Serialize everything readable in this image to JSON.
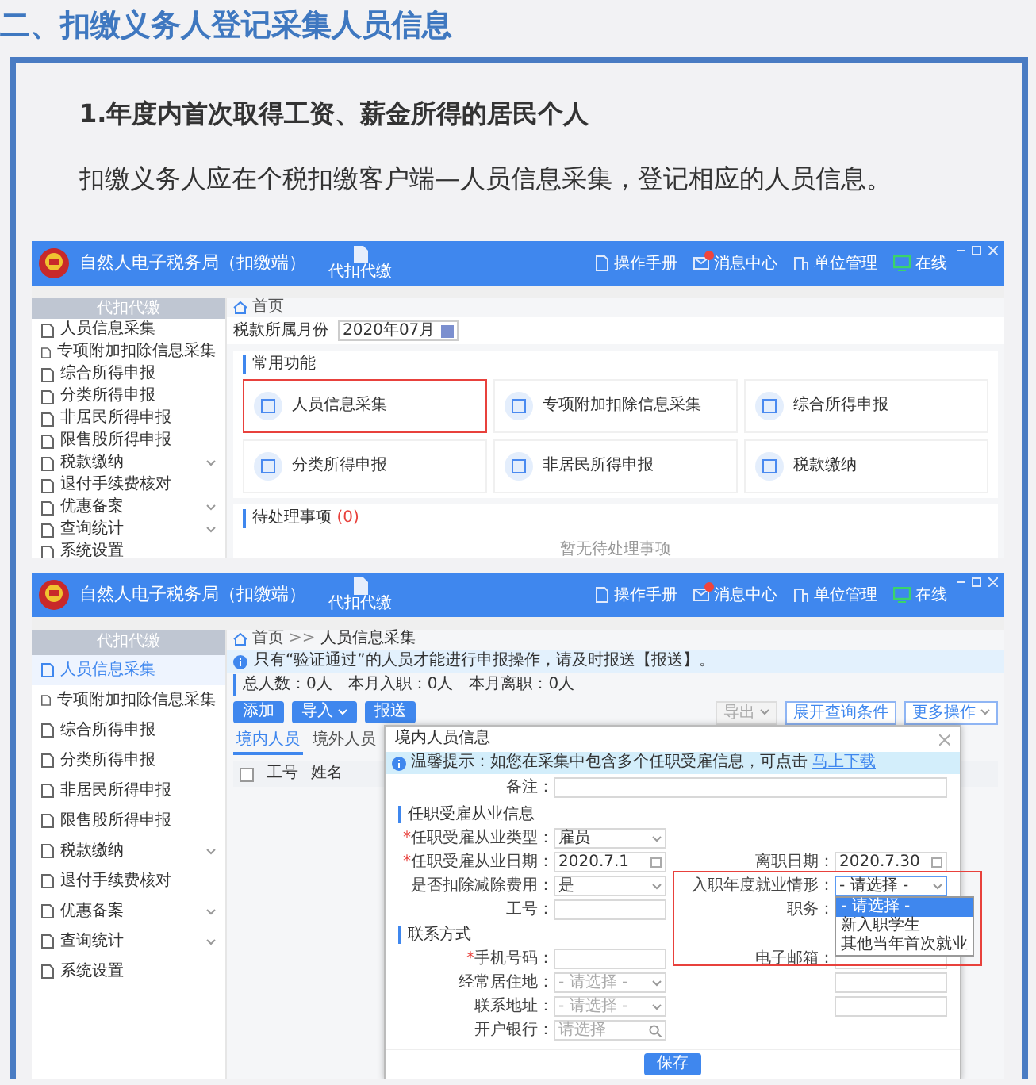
{
  "heading": "二、扣缴义务人登记采集人员信息",
  "subheading": "1.年度内首次取得工资、薪金所得的居民个人",
  "paragraph": "扣缴义务人应在个税扣缴客户端—人员信息采集，登记相应的人员信息。",
  "screenshot_1": {
    "app_title": "自然人电子税务局（扣缴端）",
    "toolbar_button": "代扣代缴",
    "header_links": [
      {
        "label": "操作手册",
        "kind": "manual",
        "badge": false
      },
      {
        "label": "消息中心",
        "kind": "message",
        "badge": true
      },
      {
        "label": "单位管理",
        "kind": "unit",
        "badge": false
      },
      {
        "label": "在线",
        "kind": "online",
        "badge": false
      }
    ],
    "sidebar_title": "代扣代缴",
    "sidebar_items": [
      {
        "label": "人员信息采集",
        "expandable": false,
        "selected": false
      },
      {
        "label": "专项附加扣除信息采集",
        "expandable": false,
        "selected": false
      },
      {
        "label": "综合所得申报",
        "expandable": false,
        "selected": false
      },
      {
        "label": "分类所得申报",
        "expandable": false,
        "selected": false
      },
      {
        "label": "非居民所得申报",
        "expandable": false,
        "selected": false
      },
      {
        "label": "限售股所得申报",
        "expandable": false,
        "selected": false
      },
      {
        "label": "税款缴纳",
        "expandable": true,
        "selected": false
      },
      {
        "label": "退付手续费核对",
        "expandable": false,
        "selected": false
      },
      {
        "label": "优惠备案",
        "expandable": true,
        "selected": false
      },
      {
        "label": "查询统计",
        "expandable": true,
        "selected": false
      },
      {
        "label": "系统设置",
        "expandable": false,
        "selected": false
      }
    ],
    "breadcrumb": [
      "首页"
    ],
    "month_label": "税款所属月份",
    "month_value": "2020年07月",
    "functions_title": "常用功能",
    "functions": [
      {
        "title": "人员信息采集",
        "highlighted": true
      },
      {
        "title": "专项附加扣除信息采集",
        "highlighted": false
      },
      {
        "title": "综合所得申报",
        "highlighted": false
      },
      {
        "title": "分类所得申报",
        "highlighted": false
      },
      {
        "title": "非居民所得申报",
        "highlighted": false
      },
      {
        "title": "税款缴纳",
        "highlighted": false
      }
    ],
    "pending_title": "待处理事项",
    "pending_count": "(0)",
    "pending_empty": "暂无待处理事项"
  },
  "screenshot_2": {
    "app_title": "自然人电子税务局（扣缴端）",
    "toolbar_button": "代扣代缴",
    "header_links": [
      {
        "label": "操作手册",
        "kind": "manual",
        "badge": false
      },
      {
        "label": "消息中心",
        "kind": "message",
        "badge": true
      },
      {
        "label": "单位管理",
        "kind": "unit",
        "badge": false
      },
      {
        "label": "在线",
        "kind": "online",
        "badge": false
      }
    ],
    "sidebar_title": "代扣代缴",
    "sidebar_items": [
      {
        "label": "人员信息采集",
        "expandable": false,
        "selected": true
      },
      {
        "label": "专项附加扣除信息采集",
        "expandable": false,
        "selected": false
      },
      {
        "label": "综合所得申报",
        "expandable": false,
        "selected": false
      },
      {
        "label": "分类所得申报",
        "expandable": false,
        "selected": false
      },
      {
        "label": "非居民所得申报",
        "expandable": false,
        "selected": false
      },
      {
        "label": "限售股所得申报",
        "expandable": false,
        "selected": false
      },
      {
        "label": "税款缴纳",
        "expandable": true,
        "selected": false
      },
      {
        "label": "退付手续费核对",
        "expandable": false,
        "selected": false
      },
      {
        "label": "优惠备案",
        "expandable": true,
        "selected": false
      },
      {
        "label": "查询统计",
        "expandable": true,
        "selected": false
      },
      {
        "label": "系统设置",
        "expandable": false,
        "selected": false
      }
    ],
    "breadcrumb": [
      "首页",
      "人员信息采集"
    ],
    "breadcrumb_separator": ">>",
    "notice": "只有“验证通过”的人员才能进行申报操作，请及时报送【报送】。",
    "stats": "总人数：0人　本月入职：0人　本月离职：0人",
    "actions": [
      {
        "label": "添加",
        "dropdown": false
      },
      {
        "label": "导入",
        "dropdown": true
      },
      {
        "label": "报送",
        "dropdown": false
      }
    ],
    "right_actions": [
      {
        "label": "导出",
        "dropdown": true,
        "disabled": true
      },
      {
        "label": "展开查询条件",
        "dropdown": false,
        "disabled": false
      },
      {
        "label": "更多操作",
        "dropdown": true,
        "disabled": false
      }
    ],
    "tabs": [
      {
        "label": "境内人员",
        "selected": true
      },
      {
        "label": "境外人员",
        "selected": false
      }
    ],
    "table_checkbox": {
      "checked": false
    },
    "table_columns": [
      "工号",
      "姓名"
    ],
    "modal": {
      "title": "境内人员信息",
      "required_mark": "*",
      "tip": "温馨提示：如您在采集中包含多个任职受雇信息，可点击",
      "tip_link": "马上下载",
      "top_field": {
        "label": "备注：",
        "kind": "text"
      },
      "sections": [
        {
          "title": "任职受雇从业信息",
          "rows": [
            {
              "left": {
                "label": "任职受雇从业类型：",
                "kind": "select",
                "value": "雇员",
                "required": true
              }
            },
            {
              "left": {
                "label": "任职受雇从业日期：",
                "kind": "date",
                "value": "2020.7.1",
                "required": true
              },
              "right": {
                "label": "离职日期：",
                "kind": "date",
                "value": "2020.7.30"
              }
            },
            {
              "left": {
                "label": "是否扣除减除费用：",
                "kind": "select",
                "value": "是"
              },
              "right": {
                "label": "入职年度就业情形：",
                "kind": "select",
                "value": "- 请选择 -",
                "highlighted": true,
                "expanded": true,
                "options": [
                  {
                    "label": "- 请选择 -",
                    "selected": true
                  },
                  {
                    "label": "新入职学生",
                    "selected": false
                  },
                  {
                    "label": "其他当年首次就业",
                    "selected": false
                  }
                ]
              }
            },
            {
              "left": {
                "label": "工号：",
                "kind": "text"
              },
              "right": {
                "label": "职务：",
                "kind": "text"
              }
            }
          ]
        },
        {
          "title": "联系方式",
          "rows": [
            {
              "left": {
                "label": "手机号码：",
                "kind": "text",
                "required": true
              },
              "right": {
                "label": "电子邮箱：",
                "kind": "text"
              }
            },
            {
              "left": {
                "label": "经常居住地：",
                "kind": "select",
                "placeholder": "- 请选择 -"
              },
              "right": {
                "kind": "text"
              }
            },
            {
              "left": {
                "label": "联系地址：",
                "kind": "select",
                "placeholder": "- 请选择 -"
              },
              "right": {
                "kind": "text"
              }
            },
            {
              "left": {
                "label": "开户银行：",
                "kind": "search",
                "placeholder": "请选择"
              }
            }
          ]
        }
      ],
      "save_button": "保存"
    }
  }
}
